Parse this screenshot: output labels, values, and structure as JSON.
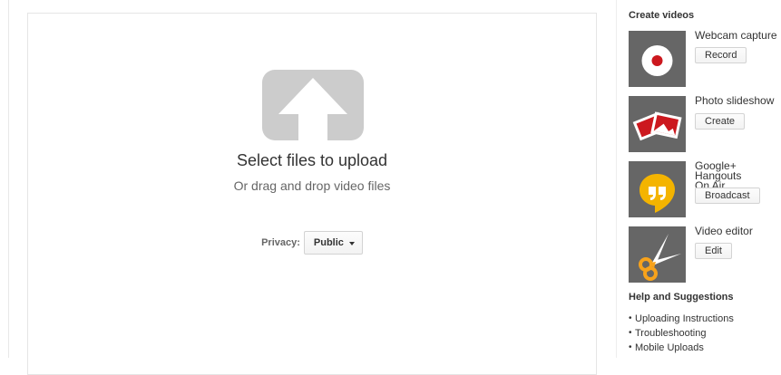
{
  "upload": {
    "title": "Select files to upload",
    "subtitle": "Or drag and drop video files",
    "privacy_label": "Privacy:",
    "privacy_value": "Public"
  },
  "sidebar": {
    "create_title": "Create videos",
    "items": [
      {
        "label": "Webcam capture",
        "button": "Record",
        "icon": "record-icon"
      },
      {
        "label": "Photo slideshow",
        "button": "Create",
        "icon": "photos-icon"
      },
      {
        "label_line1": "Google+ Hangouts",
        "label_line2": "On Air",
        "button": "Broadcast",
        "icon": "hangouts-icon"
      },
      {
        "label": "Video editor",
        "button": "Edit",
        "icon": "scissors-icon"
      }
    ],
    "help_title": "Help and Suggestions",
    "help_links": [
      "Uploading Instructions",
      "Troubleshooting",
      "Mobile Uploads"
    ]
  },
  "colors": {
    "thumb_bg": "#666666",
    "record_red": "#cc181e",
    "hangouts_yellow": "#f4b400",
    "scissors_orange": "#f7a21b",
    "upload_icon_gray": "#cccccc"
  }
}
